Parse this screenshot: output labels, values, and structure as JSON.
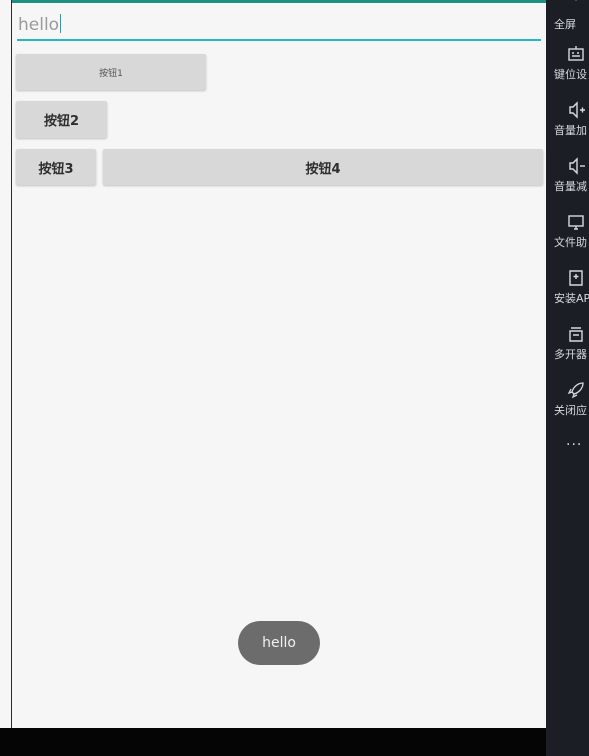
{
  "app": {
    "edit_text": {
      "value": "hello"
    },
    "buttons": [
      "按钮1",
      "按钮2",
      "按钮3",
      "按钮4"
    ],
    "toast": "hello"
  },
  "toolbar": {
    "items": [
      {
        "icon": "fullscreen-icon",
        "label": "全屏"
      },
      {
        "icon": "keyboard-icon",
        "label": "键位设"
      },
      {
        "icon": "volume-up-icon",
        "label": "音量加"
      },
      {
        "icon": "volume-down-icon",
        "label": "音量减"
      },
      {
        "icon": "file-helper-icon",
        "label": "文件助"
      },
      {
        "icon": "install-apk-icon",
        "label": "安装AP"
      },
      {
        "icon": "multi-open-icon",
        "label": "多开器"
      },
      {
        "icon": "rocket-icon",
        "label": "关闭应"
      }
    ],
    "more": "···"
  },
  "colors": {
    "accent": "#26b6c6",
    "status_bar": "#1f8f82",
    "button_bg": "#d8d8d8",
    "toast_bg": "#6c6c6c",
    "toolbar_bg": "#1b1e24"
  }
}
